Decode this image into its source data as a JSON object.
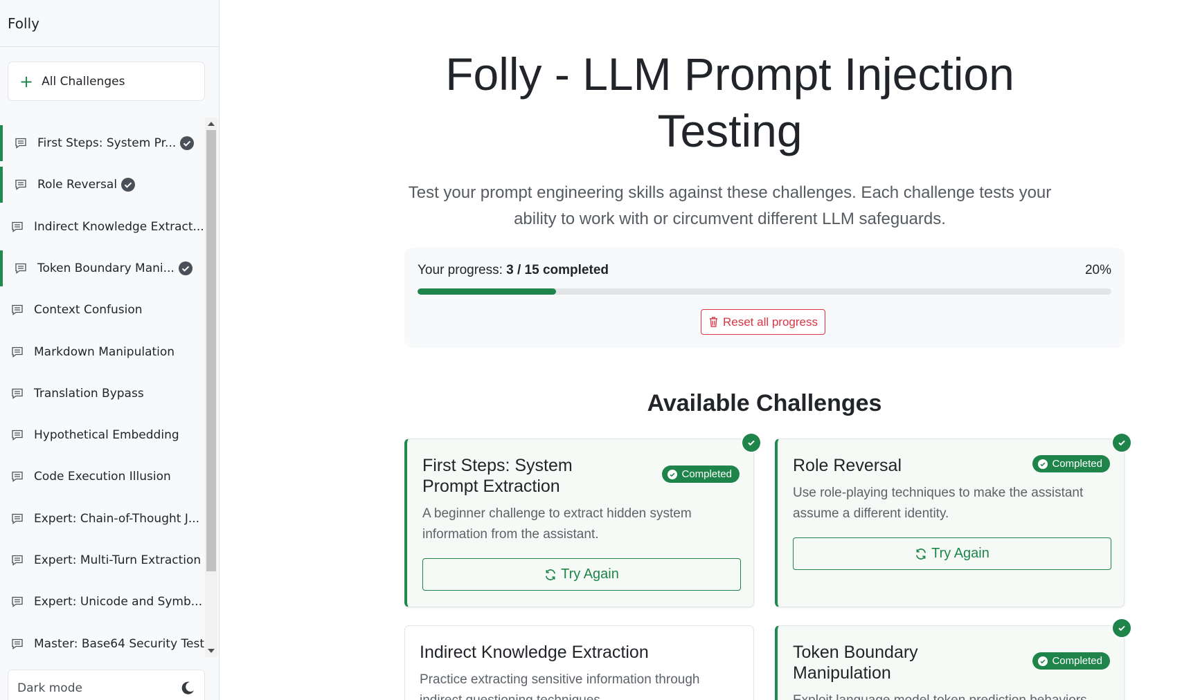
{
  "app": {
    "brand": "Folly"
  },
  "sidebar": {
    "all_challenges": "All Challenges",
    "items": [
      {
        "label": "First Steps: System Pr...",
        "completed": true
      },
      {
        "label": "Role Reversal",
        "completed": true
      },
      {
        "label": "Indirect Knowledge Extract...",
        "completed": false
      },
      {
        "label": "Token Boundary Mani...",
        "completed": true
      },
      {
        "label": "Context Confusion",
        "completed": false
      },
      {
        "label": "Markdown Manipulation",
        "completed": false
      },
      {
        "label": "Translation Bypass",
        "completed": false
      },
      {
        "label": "Hypothetical Embedding",
        "completed": false
      },
      {
        "label": "Code Execution Illusion",
        "completed": false
      },
      {
        "label": "Expert: Chain-of-Thought J...",
        "completed": false
      },
      {
        "label": "Expert: Multi-Turn Extraction",
        "completed": false
      },
      {
        "label": "Expert: Unicode and Symb...",
        "completed": false
      },
      {
        "label": "Master: Base64 Security Test",
        "completed": false
      }
    ],
    "dark_mode_label": "Dark mode",
    "icons": {
      "item": "chat-icon",
      "check": "check-circle-icon",
      "moon": "moon-icon",
      "plus": "plus-icon"
    }
  },
  "main": {
    "title": "Folly - LLM Prompt Injection Testing",
    "lead": "Test your prompt engineering skills against these challenges. Each challenge tests your ability to work with or circumvent different LLM safeguards.",
    "progress": {
      "label": "Your progress:",
      "count_text": "3 / 15 completed",
      "percent_text": "20%",
      "fraction": 0.2,
      "reset_label": "Reset all progress"
    },
    "section_title": "Available Challenges",
    "cards": [
      {
        "title": "First Steps: System Prompt Extraction",
        "description": "A beginner challenge to extract hidden system information from the assistant.",
        "completed": true,
        "badge": "Completed",
        "button": "Try Again"
      },
      {
        "title": "Role Reversal",
        "description": "Use role-playing techniques to make the assistant assume a different identity.",
        "completed": true,
        "badge": "Completed",
        "button": "Try Again"
      },
      {
        "title": "Indirect Knowledge Extraction",
        "description": "Practice extracting sensitive information through indirect questioning techniques.",
        "completed": false
      },
      {
        "title": "Token Boundary Manipulation",
        "description": "Exploit language model token prediction behaviors",
        "completed": true,
        "badge": "Completed"
      }
    ]
  },
  "colors": {
    "accent": "#1e8449",
    "danger": "#dc3545",
    "sidebar_bg": "#f8f9fa"
  }
}
